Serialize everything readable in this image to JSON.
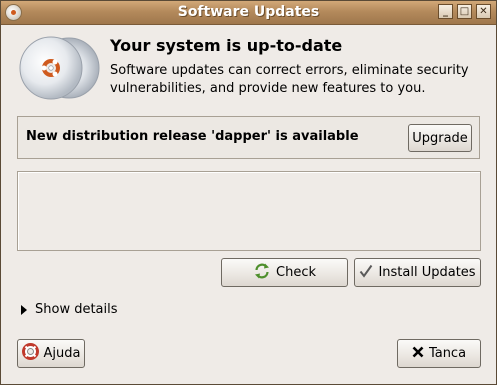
{
  "window": {
    "title": "Software Updates",
    "minimize_glyph": "_",
    "maximize_glyph": "□",
    "close_glyph": "✕"
  },
  "status": {
    "heading": "Your system is up-to-date",
    "description": "Software updates can correct errors, eliminate security vulnerabilities, and provide new features to you."
  },
  "release": {
    "message": "New distribution release 'dapper' is available",
    "upgrade_label": "Upgrade"
  },
  "actions": {
    "check_label": "Check",
    "install_label": "Install Updates"
  },
  "details": {
    "label": "Show details"
  },
  "footer": {
    "help_label": "Ajuda",
    "close_label": "Tanca"
  },
  "icons": {
    "logo": "ubuntu-cd-icon",
    "check": "refresh-icon",
    "install": "checkmark-icon",
    "help": "lifebuoy-icon",
    "close": "close-x-icon",
    "expander": "expander-arrow-icon"
  },
  "colors": {
    "titlebar": "#b48a5c",
    "window_bg": "#efebe7",
    "ubuntu_orange": "#cf5a1e"
  }
}
